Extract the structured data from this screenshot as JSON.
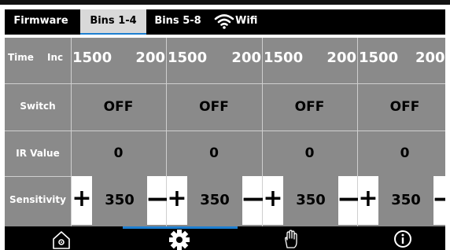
{
  "tabs": [
    {
      "label": "Firmware",
      "active": false
    },
    {
      "label": "Bins 1-4",
      "active": true
    },
    {
      "label": "Bins 5-8",
      "active": false
    },
    {
      "label": "Wifi",
      "active": false,
      "icon": "wifi-icon"
    }
  ],
  "rows": {
    "time_label": "Time",
    "inc_label": "Inc",
    "switch_label": "Switch",
    "ir_label": "IR Value",
    "sensitivity_label": "Sensitivity"
  },
  "bins": [
    {
      "time": "1500",
      "inc": "200",
      "switch": "OFF",
      "ir": "0",
      "sensitivity": "350"
    },
    {
      "time": "1500",
      "inc": "200",
      "switch": "OFF",
      "ir": "0",
      "sensitivity": "350"
    },
    {
      "time": "1500",
      "inc": "200",
      "switch": "OFF",
      "ir": "0",
      "sensitivity": "350"
    },
    {
      "time": "1500",
      "inc": "200",
      "switch": "OFF",
      "ir": "0",
      "sensitivity": "350"
    }
  ],
  "controls": {
    "plus": "+",
    "minus": "—"
  },
  "nav": [
    {
      "icon": "home-icon",
      "active": false
    },
    {
      "icon": "gear-icon",
      "active": true
    },
    {
      "icon": "hand-icon",
      "active": false
    },
    {
      "icon": "info-icon",
      "active": false
    }
  ],
  "colors": {
    "accent": "#1e7fd0",
    "cell_bg": "#8a8a8a",
    "bar_bg": "#000000"
  }
}
